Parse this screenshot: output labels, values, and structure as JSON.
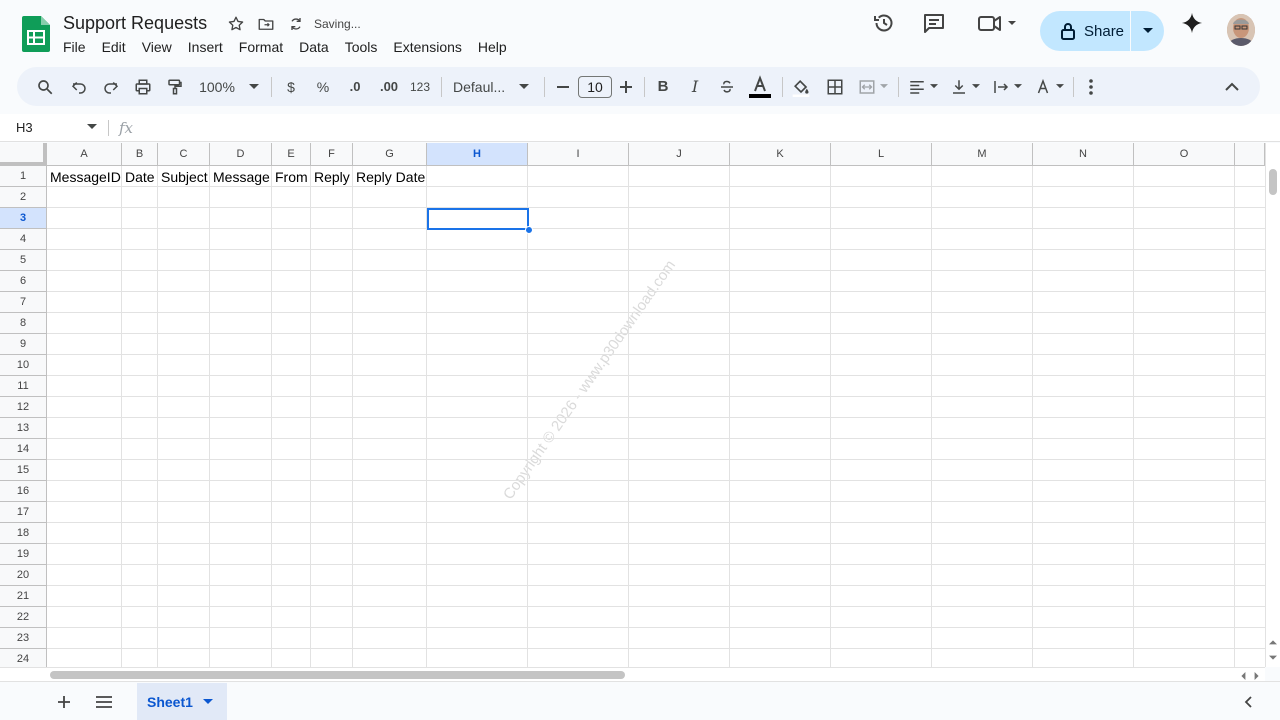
{
  "document": {
    "title": "Support Requests",
    "status": "Saving..."
  },
  "menu": [
    "File",
    "Edit",
    "View",
    "Insert",
    "Format",
    "Data",
    "Tools",
    "Extensions",
    "Help"
  ],
  "header": {
    "share_label": "Share",
    "icons": [
      "history-icon",
      "comment-icon",
      "meet-icon",
      "gemini-icon"
    ]
  },
  "toolbar": {
    "zoom": "100%",
    "currency": "$",
    "percent": "%",
    "dec_decrease": ".0",
    "dec_increase": ".00",
    "number_format": "123",
    "font": "Defaul...",
    "font_size": "10",
    "bold": "B",
    "italic": "I"
  },
  "formula_bar": {
    "cell_ref": "H3",
    "fx_label": "fx"
  },
  "sheet": {
    "columns": [
      "A",
      "B",
      "C",
      "D",
      "E",
      "F",
      "G",
      "H",
      "I",
      "J",
      "K",
      "L",
      "M",
      "N",
      "O"
    ],
    "rows": [
      "1",
      "2",
      "3",
      "4",
      "5",
      "6",
      "7",
      "8",
      "9",
      "10",
      "11",
      "12",
      "13",
      "14",
      "15",
      "16",
      "17",
      "18",
      "19",
      "20",
      "21",
      "22",
      "23",
      "24"
    ],
    "header_row": [
      "MessageID",
      "Date",
      "Subject",
      "Message",
      "From",
      "Reply",
      "Reply Date"
    ],
    "selected_cell": "H3"
  },
  "watermark": "Copyright © 2026 - www.p30download.com",
  "tabs": {
    "active": "Sheet1"
  },
  "colors": {
    "accent": "#0b57d0",
    "share_bg": "#c2e7ff",
    "toolbar_bg": "#edf2fa",
    "selection": "#1a73e8"
  }
}
